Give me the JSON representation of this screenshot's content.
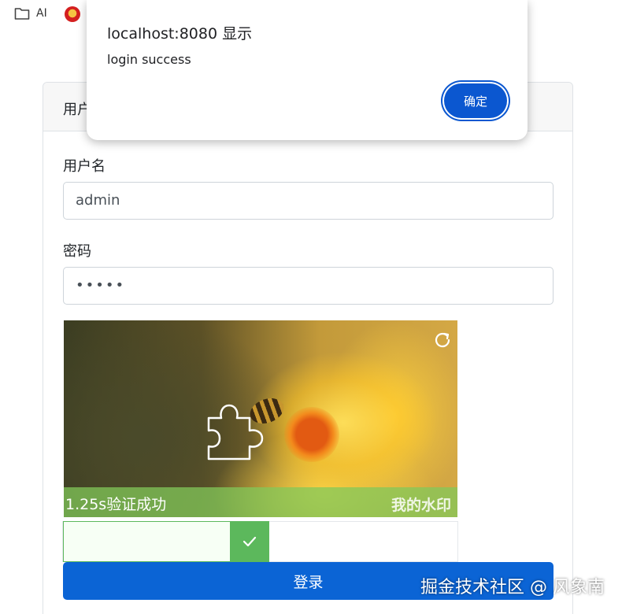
{
  "bookmarks": {
    "items": [
      {
        "label": "AI",
        "icon": "folder-icon"
      },
      {
        "label": "",
        "icon": "national-emblem-icon"
      }
    ]
  },
  "card": {
    "header_title": "用户登录",
    "username_label": "用户名",
    "username_value": "admin",
    "password_label": "密码",
    "password_value": "•••••",
    "login_button": "登录"
  },
  "captcha": {
    "message": "1.25s验证成功",
    "watermark": "我的水印",
    "refresh_icon": "refresh-icon",
    "slider_status": "success",
    "slider_icon": "check-icon",
    "slider_progress_fraction": 0.47,
    "colors": {
      "success": "#5cb85c"
    }
  },
  "dialog": {
    "title": "localhost:8080 显示",
    "message": "login success",
    "ok_label": "确定"
  },
  "overlay": {
    "site_watermark": "掘金技术社区 @ 风象南"
  },
  "colors": {
    "primary": "#0b64d5",
    "dialog_button": "#0b57d0"
  }
}
